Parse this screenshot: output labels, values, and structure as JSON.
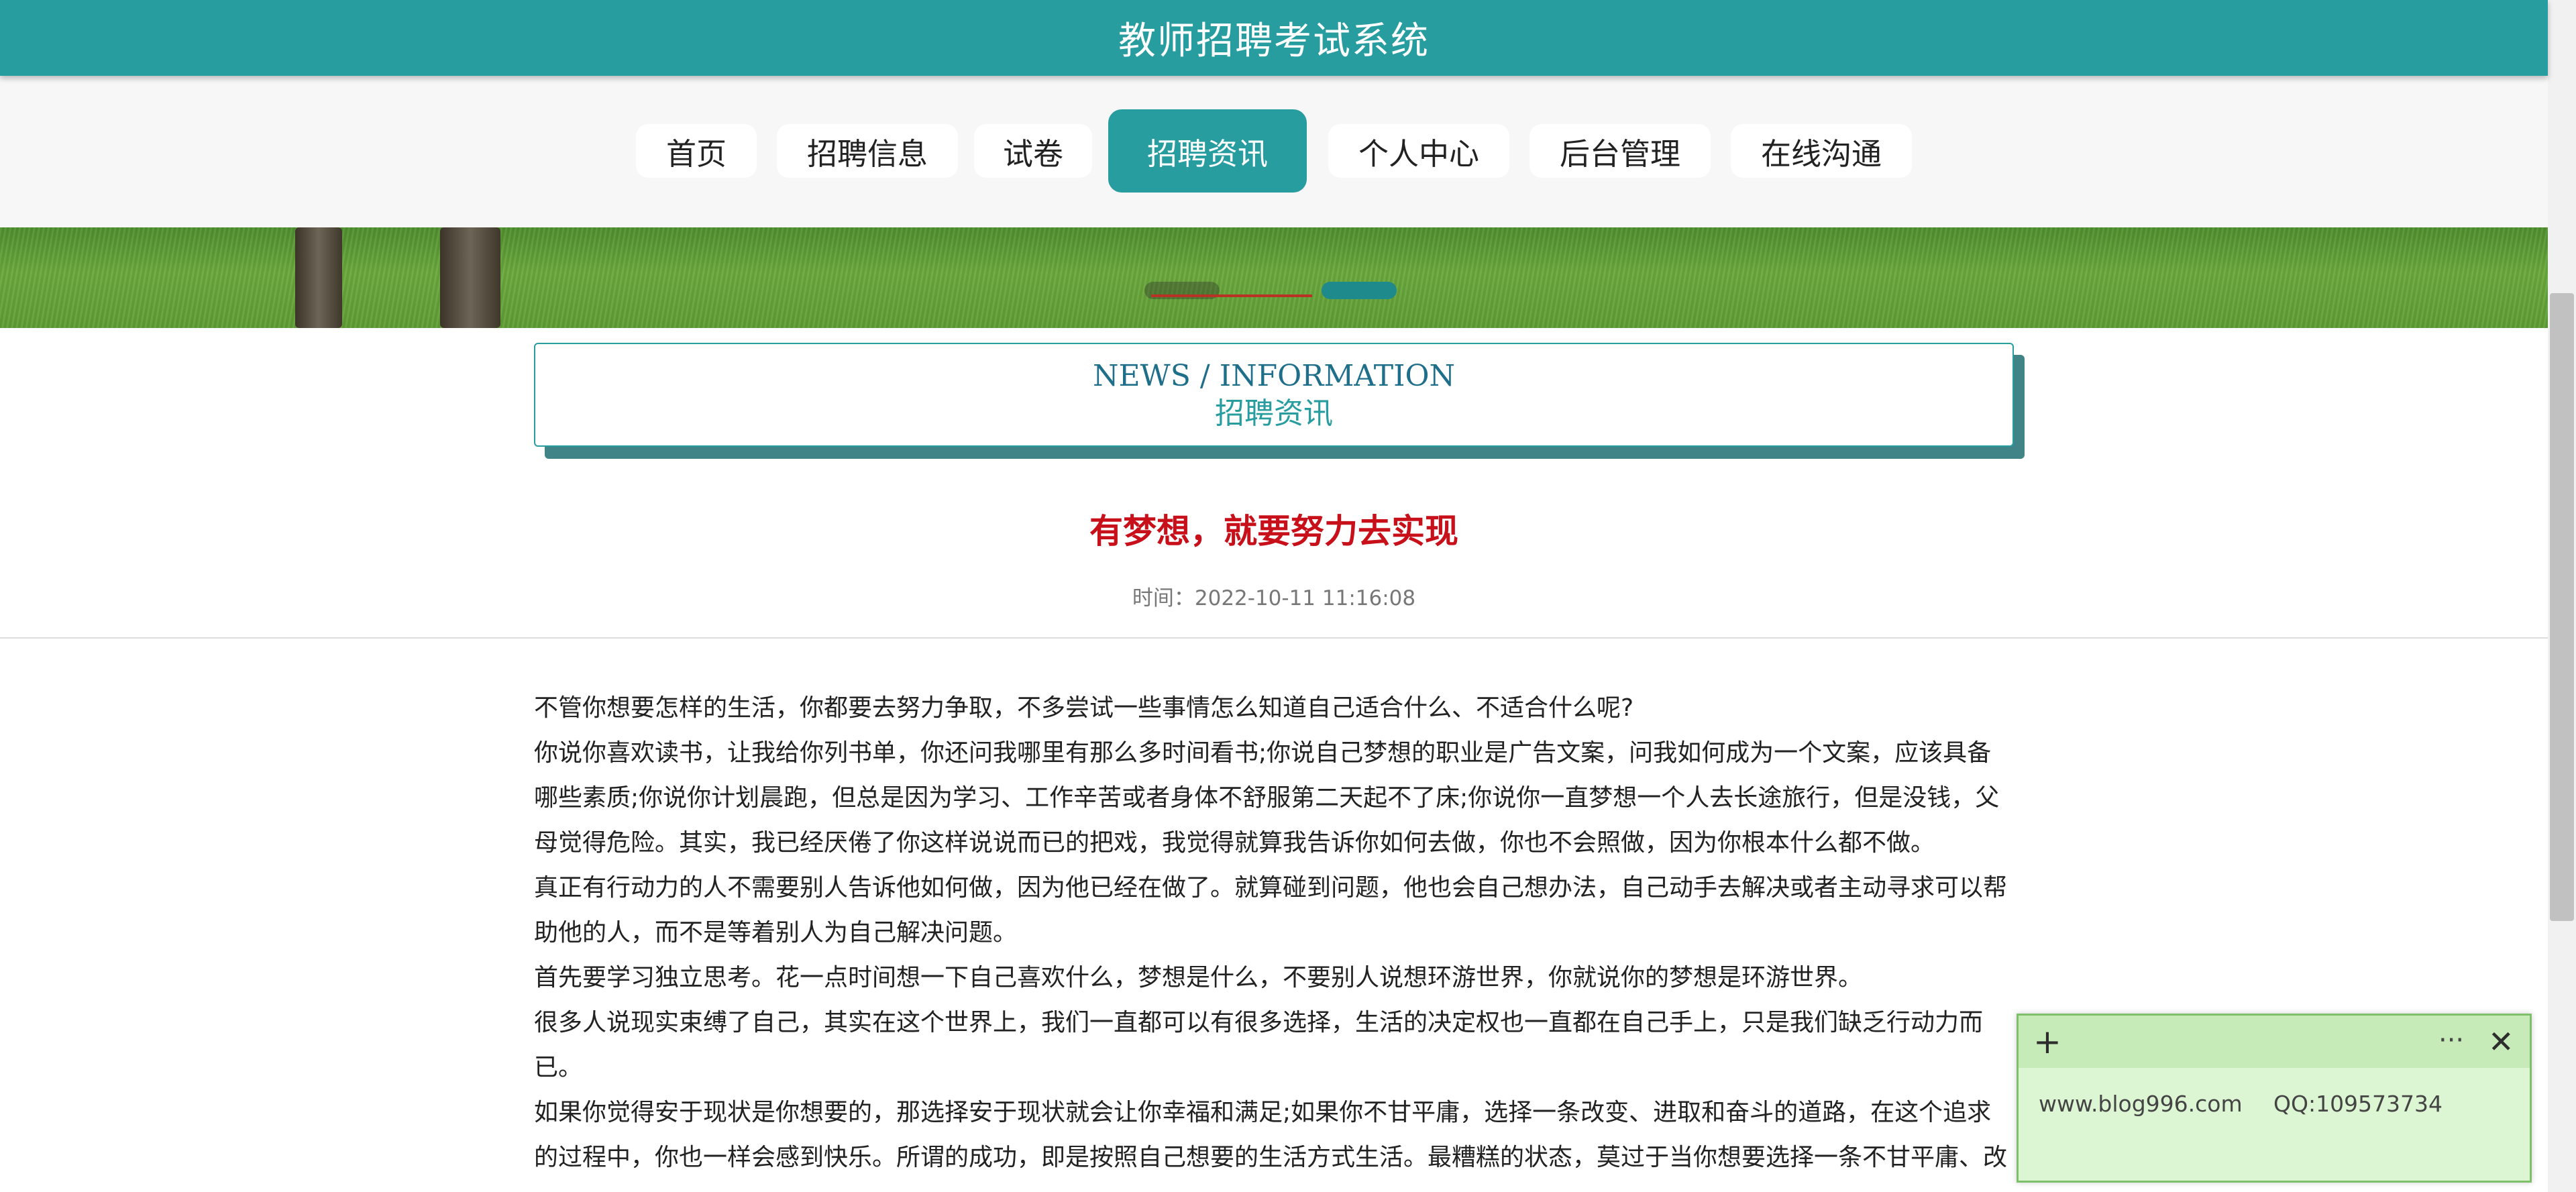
{
  "header": {
    "title": "教师招聘考试系统"
  },
  "nav": {
    "items": [
      {
        "label": "首页",
        "active": false
      },
      {
        "label": "招聘信息",
        "active": false
      },
      {
        "label": "试卷",
        "active": false
      },
      {
        "label": "招聘资讯",
        "active": true
      },
      {
        "label": "个人中心",
        "active": false
      },
      {
        "label": "后台管理",
        "active": false
      },
      {
        "label": "在线沟通",
        "active": false
      }
    ]
  },
  "banner": {
    "slide_count": 2,
    "active_slide": 2
  },
  "section": {
    "title_en": "NEWS / INFORMATION",
    "title_cn": "招聘资讯"
  },
  "article": {
    "title": "有梦想，就要努力去实现",
    "time": "时间：2022-10-11 11:16:08",
    "paragraphs": [
      "不管你想要怎样的生活，你都要去努力争取，不多尝试一些事情怎么知道自己适合什么、不适合什么呢?",
      "你说你喜欢读书，让我给你列书单，你还问我哪里有那么多时间看书;你说自己梦想的职业是广告文案，问我如何成为一个文案，应该具备哪些素质;你说你计划晨跑，但总是因为学习、工作辛苦或者身体不舒服第二天起不了床;你说你一直梦想一个人去长途旅行，但是没钱，父母觉得危险。其实，我已经厌倦了你这样说说而已的把戏，我觉得就算我告诉你如何去做，你也不会照做，因为你根本什么都不做。",
      "真正有行动力的人不需要别人告诉他如何做，因为他已经在做了。就算碰到问题，他也会自己想办法，自己动手去解决或者主动寻求可以帮助他的人，而不是等着别人为自己解决问题。",
      "首先要学习独立思考。花一点时间想一下自己喜欢什么，梦想是什么，不要别人说想环游世界，你就说你的梦想是环游世界。",
      "很多人说现实束缚了自己，其实在这个世界上，我们一直都可以有很多选择，生活的决定权也一直都在自己手上，只是我们缺乏行动力而已。",
      "如果你觉得安于现状是你想要的，那选择安于现状就会让你幸福和满足;如果你不甘平庸，选择一条改变、进取和奋斗的道路，在这个追求的过程中，你也一样会感到快乐。所谓的成功，即是按照自己想要的生活方式生活。最糟糕的状态，莫过于当你想要选择一条不甘平庸、改"
    ]
  },
  "widget": {
    "plus_icon": "+",
    "more_icon": "···",
    "close_icon": "✕",
    "site": "www.blog996.com",
    "qq": "QQ:109573734"
  }
}
